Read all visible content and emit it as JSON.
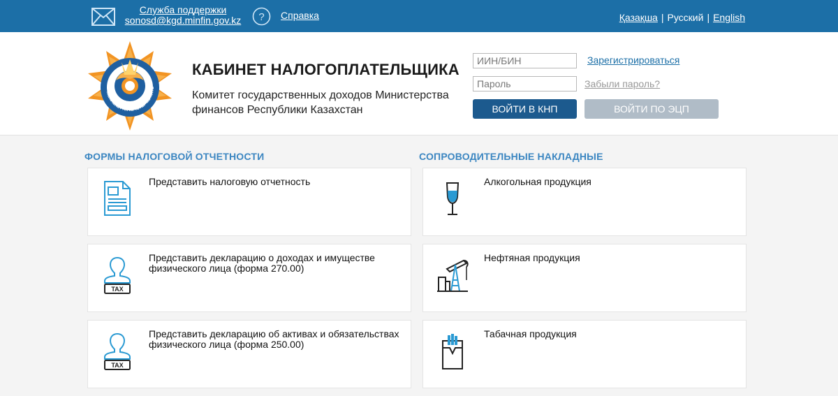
{
  "topbar": {
    "support_title": "Служба поддержки",
    "support_email": "sonosd@kgd.minfin.gov.kz",
    "help_label": "Справка",
    "languages": [
      {
        "label": "Қазақша",
        "active": false
      },
      {
        "label": "Русский",
        "active": true
      },
      {
        "label": "English",
        "active": false
      }
    ],
    "separator": "|"
  },
  "header": {
    "title": "КАБИНЕТ НАЛОГОПЛАТЕЛЬЩИКА",
    "subtitle": "Комитет государственных доходов Министерства финансов Республики Казахстан",
    "logo_ring_text": "МЕМЛЕКЕТТІК КІРІСТЕР КОМИТЕТІ"
  },
  "login": {
    "iin_placeholder": "ИИН/БИН",
    "password_placeholder": "Пароль",
    "register_label": "Зарегистрироваться",
    "forgot_label": "Забыли пароль?",
    "login_knp_label": "ВОЙТИ В КНП",
    "login_ecp_label": "ВОЙТИ ПО ЭЦП"
  },
  "sections": {
    "reports_title": "ФОРМЫ НАЛОГОВОЙ ОТЧЕТНОСТИ",
    "invoices_title": "СОПРОВОДИТЕЛЬНЫЕ НАКЛАДНЫЕ",
    "reports": [
      {
        "label": "Представить налоговую отчетность",
        "icon": "document-icon"
      },
      {
        "label": "Представить декларацию о доходах и имуществе физического лица (форма 270.00)",
        "icon": "person-tax-icon",
        "badge": "TAX"
      },
      {
        "label": "Представить декларацию об активах и обязательствах физического лица (форма 250.00)",
        "icon": "person-tax-icon",
        "badge": "TAX"
      }
    ],
    "invoices": [
      {
        "label": "Алкогольная продукция",
        "icon": "wine-glass-icon"
      },
      {
        "label": "Нефтяная продукция",
        "icon": "oil-pump-icon"
      },
      {
        "label": "Табачная продукция",
        "icon": "cigarette-pack-icon"
      }
    ]
  },
  "colors": {
    "topbar": "#1c6fa7",
    "accent": "#3b86c1",
    "primary_button": "#1c5a8e",
    "disabled_button": "#b0bcc7",
    "logo_orange": "#f29423",
    "logo_blue": "#1f5fa0"
  }
}
